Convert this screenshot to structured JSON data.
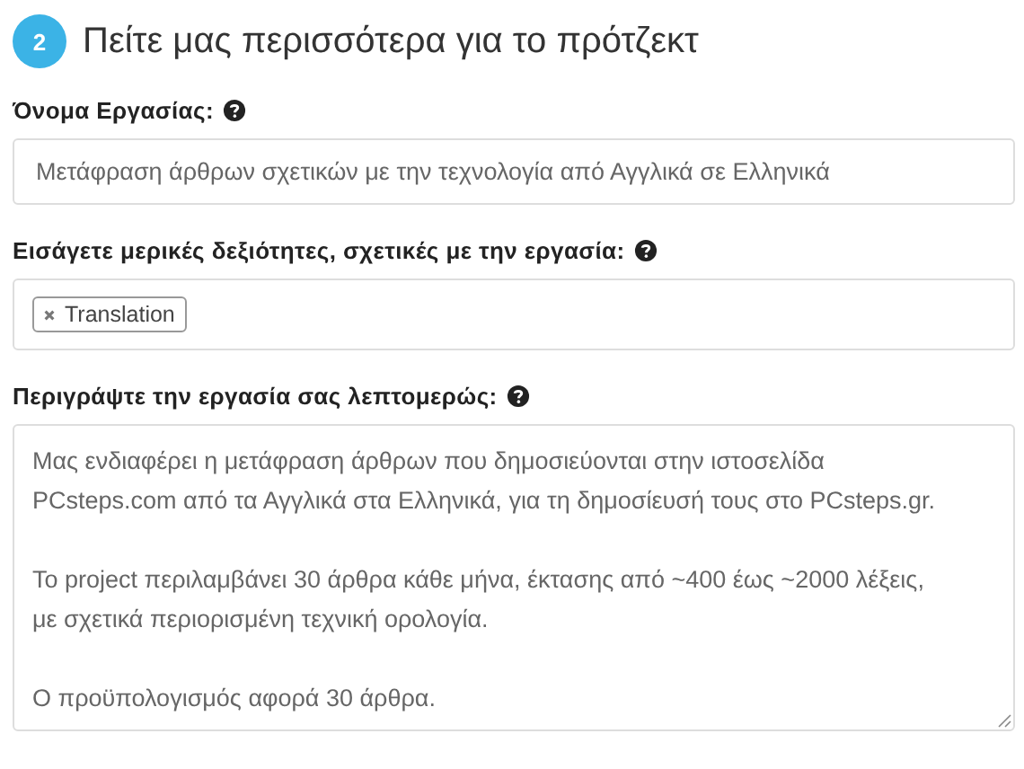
{
  "step": {
    "number": "2",
    "title": "Πείτε μας περισσότερα για το πρότζεκτ"
  },
  "fields": [
    {
      "kind": "text",
      "label": "Όνομα Εργασίας:",
      "value": "Μετάφραση άρθρων σχετικών με την τεχνολογία από Αγγλικά σε Ελληνικά"
    },
    {
      "kind": "tags",
      "label": "Εισάγετε μερικές δεξιότητες, σχετικές με την εργασία:",
      "tags": [
        "Translation"
      ]
    },
    {
      "kind": "textarea",
      "label": "Περιγράψτε την εργασία σας λεπτομερώς:",
      "paragraphs": [
        [
          "Μας ενδιαφέρει η μετάφραση άρθρων που δημοσιεύονται στην ιστοσελίδα",
          "PCsteps.com από τα Αγγλικά στα Ελληνικά, για τη δημοσίευσή τους στο PCsteps.gr."
        ],
        [
          "Το project περιλαμβάνει 30 άρθρα κάθε μήνα, έκτασης από ~400 έως ~2000 λέξεις,",
          "με σχετικά περιορισμένη τεχνική ορολογία."
        ],
        [
          "Ο προϋπολογισμός αφορά 30 άρθρα."
        ]
      ]
    }
  ]
}
